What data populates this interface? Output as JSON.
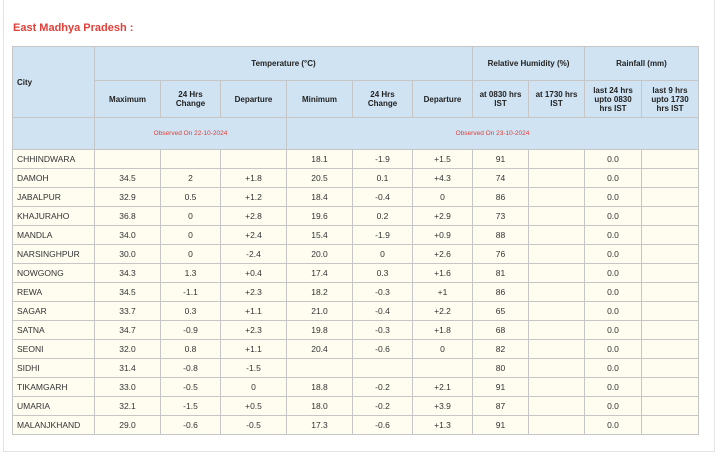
{
  "title": "East Madhya Pradesh :",
  "headers": {
    "city": "City",
    "temperature_group": "Temperature (°C)",
    "humidity_group": "Relative Humidity (%)",
    "rainfall_group": "Rainfall (mm)",
    "maximum": "Maximum",
    "max_change": "24 Hrs Change",
    "max_departure": "Departure",
    "minimum": "Minimum",
    "min_change": "24 Hrs Change",
    "min_departure": "Departure",
    "rh_0830": "at 0830 hrs IST",
    "rh_1730": "at 1730 hrs IST",
    "rain_24": "last 24 hrs upto 0830 hrs IST",
    "rain_9": "last 9 hrs upto 1730 hrs IST"
  },
  "observed": {
    "max": "Observed On 22-10-2024",
    "min": "Observed On 23-10-2024"
  },
  "rows": [
    {
      "city": "CHHINDWARA",
      "max": "",
      "max_change": "",
      "max_dep": "",
      "min": "18.1",
      "min_change": "-1.9",
      "min_dep": "+1.5",
      "rh_0830": "91",
      "rh_1730": "",
      "rain_24": "0.0",
      "rain_9": ""
    },
    {
      "city": "DAMOH",
      "max": "34.5",
      "max_change": "2",
      "max_dep": "+1.8",
      "min": "20.5",
      "min_change": "0.1",
      "min_dep": "+4.3",
      "rh_0830": "74",
      "rh_1730": "",
      "rain_24": "0.0",
      "rain_9": ""
    },
    {
      "city": "JABALPUR",
      "max": "32.9",
      "max_change": "0.5",
      "max_dep": "+1.2",
      "min": "18.4",
      "min_change": "-0.4",
      "min_dep": "0",
      "rh_0830": "86",
      "rh_1730": "",
      "rain_24": "0.0",
      "rain_9": ""
    },
    {
      "city": "KHAJURAHO",
      "max": "36.8",
      "max_change": "0",
      "max_dep": "+2.8",
      "min": "19.6",
      "min_change": "0.2",
      "min_dep": "+2.9",
      "rh_0830": "73",
      "rh_1730": "",
      "rain_24": "0.0",
      "rain_9": ""
    },
    {
      "city": "MANDLA",
      "max": "34.0",
      "max_change": "0",
      "max_dep": "+2.4",
      "min": "15.4",
      "min_change": "-1.9",
      "min_dep": "+0.9",
      "rh_0830": "88",
      "rh_1730": "",
      "rain_24": "0.0",
      "rain_9": ""
    },
    {
      "city": "NARSINGHPUR",
      "max": "30.0",
      "max_change": "0",
      "max_dep": "-2.4",
      "min": "20.0",
      "min_change": "0",
      "min_dep": "+2.6",
      "rh_0830": "76",
      "rh_1730": "",
      "rain_24": "0.0",
      "rain_9": ""
    },
    {
      "city": "NOWGONG",
      "max": "34.3",
      "max_change": "1.3",
      "max_dep": "+0.4",
      "min": "17.4",
      "min_change": "0.3",
      "min_dep": "+1.6",
      "rh_0830": "81",
      "rh_1730": "",
      "rain_24": "0.0",
      "rain_9": ""
    },
    {
      "city": "REWA",
      "max": "34.5",
      "max_change": "-1.1",
      "max_dep": "+2.3",
      "min": "18.2",
      "min_change": "-0.3",
      "min_dep": "+1",
      "rh_0830": "86",
      "rh_1730": "",
      "rain_24": "0.0",
      "rain_9": ""
    },
    {
      "city": "SAGAR",
      "max": "33.7",
      "max_change": "0.3",
      "max_dep": "+1.1",
      "min": "21.0",
      "min_change": "-0.4",
      "min_dep": "+2.2",
      "rh_0830": "65",
      "rh_1730": "",
      "rain_24": "0.0",
      "rain_9": ""
    },
    {
      "city": "SATNA",
      "max": "34.7",
      "max_change": "-0.9",
      "max_dep": "+2.3",
      "min": "19.8",
      "min_change": "-0.3",
      "min_dep": "+1.8",
      "rh_0830": "68",
      "rh_1730": "",
      "rain_24": "0.0",
      "rain_9": ""
    },
    {
      "city": "SEONI",
      "max": "32.0",
      "max_change": "0.8",
      "max_dep": "+1.1",
      "min": "20.4",
      "min_change": "-0.6",
      "min_dep": "0",
      "rh_0830": "82",
      "rh_1730": "",
      "rain_24": "0.0",
      "rain_9": ""
    },
    {
      "city": "SIDHI",
      "max": "31.4",
      "max_change": "-0.8",
      "max_dep": "-1.5",
      "min": "",
      "min_change": "",
      "min_dep": "",
      "rh_0830": "80",
      "rh_1730": "",
      "rain_24": "0.0",
      "rain_9": ""
    },
    {
      "city": "TIKAMGARH",
      "max": "33.0",
      "max_change": "-0.5",
      "max_dep": "0",
      "min": "18.8",
      "min_change": "-0.2",
      "min_dep": "+2.1",
      "rh_0830": "91",
      "rh_1730": "",
      "rain_24": "0.0",
      "rain_9": ""
    },
    {
      "city": "UMARIA",
      "max": "32.1",
      "max_change": "-1.5",
      "max_dep": "+0.5",
      "min": "18.0",
      "min_change": "-0.2",
      "min_dep": "+3.9",
      "rh_0830": "87",
      "rh_1730": "",
      "rain_24": "0.0",
      "rain_9": ""
    },
    {
      "city": "MALANJKHAND",
      "max": "29.0",
      "max_change": "-0.6",
      "max_dep": "-0.5",
      "min": "17.3",
      "min_change": "-0.6",
      "min_dep": "+1.3",
      "rh_0830": "91",
      "rh_1730": "",
      "rain_24": "0.0",
      "rain_9": ""
    }
  ]
}
